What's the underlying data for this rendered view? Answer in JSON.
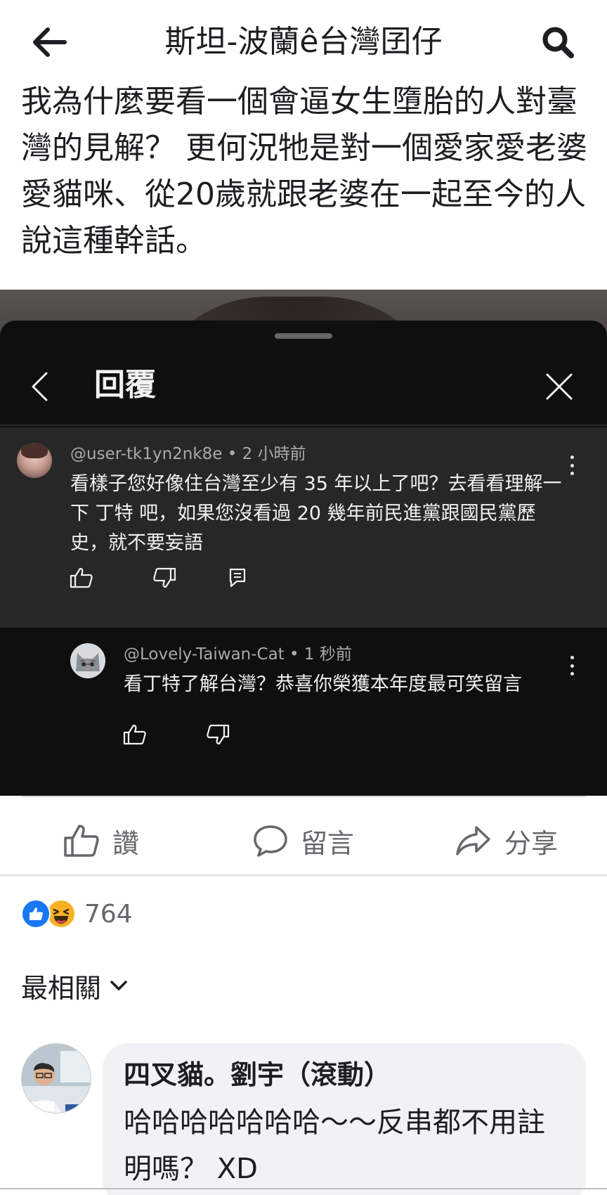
{
  "header": {
    "title": "斯坦-波蘭ê台灣囝仔"
  },
  "post": {
    "text": "我為什麼要看一個會逼女生墮胎的人對臺灣的見解？ 更何況牠是對一個愛家愛老婆愛貓咪、從20歲就跟老婆在一起至今的人說這種幹話。"
  },
  "sheet": {
    "title": "回覆",
    "main_comment": {
      "meta": "@user-tk1yn2nk8e • 2 小時前",
      "text": "看樣子您好像住台灣至少有 35 年以上了吧？去看看理解一下  丁特  吧，如果您沒看過 20 幾年前民進黨跟國民黨歷史，就不要妄語"
    },
    "reply_comment": {
      "meta": "@Lovely-Taiwan-Cat • 1 秒前",
      "text": "看丁特了解台灣？恭喜你榮獲本年度最可笑留言"
    }
  },
  "actions": {
    "like_label": "讚",
    "comment_label": "留言",
    "share_label": "分享"
  },
  "reactions": {
    "count": "764"
  },
  "sort": {
    "label": "最相關"
  },
  "fb_comment": {
    "name": "四叉貓。劉宇（滾動）",
    "text": "哈哈哈哈哈哈哈～～反串都不用註明嗎？ XD"
  },
  "colors": {
    "fb_blue": "#1877f2",
    "haha_yellow": "#f7b125",
    "sheet_dark": "#0f0f0f",
    "comment_highlight": "#272727"
  }
}
